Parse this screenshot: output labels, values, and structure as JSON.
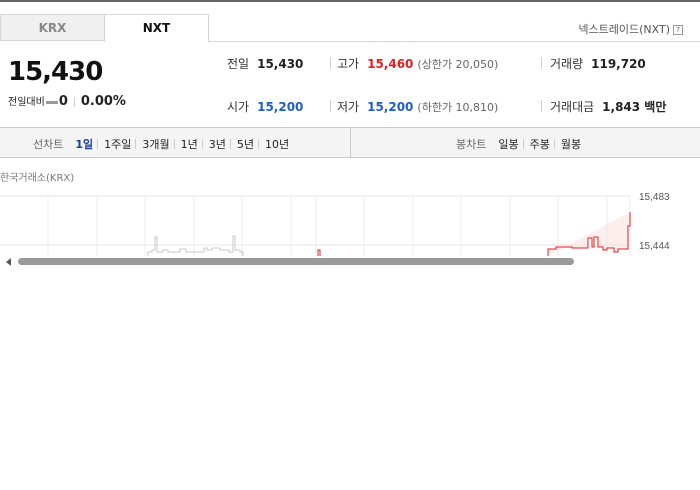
{
  "market_tabs": [
    {
      "label": "KRX",
      "active": false
    },
    {
      "label": "NXT",
      "active": true
    }
  ],
  "nxt_title": "넥스트레이드(NXT)",
  "help_icon": "?",
  "price": "15,430",
  "change": {
    "label": "전일대비",
    "value": "0",
    "percent": "0.00%"
  },
  "quote": {
    "prev_label": "전일",
    "prev": "15,430",
    "high_label": "고가",
    "high": "15,460",
    "upper_limit": "(상한가 20,050)",
    "volume_label": "거래량",
    "volume": "119,720",
    "open_label": "시가",
    "open": "15,200",
    "low_label": "저가",
    "low": "15,200",
    "lower_limit": "(하한가 10,810)",
    "amount_label": "거래대금",
    "amount": "1,843 백만"
  },
  "line_chart_ctrl": {
    "label": "선차트",
    "items": [
      "1일",
      "1주일",
      "3개월",
      "1년",
      "3년",
      "5년",
      "10년"
    ],
    "selected": "1일"
  },
  "candle_chart_ctrl": {
    "label": "봉차트",
    "items": [
      "일봉",
      "주봉",
      "월봉"
    ]
  },
  "exchange_label": "한국거래소(KRX)",
  "chart_axis": {
    "top_label": "15,483",
    "mid_label": "15,444"
  },
  "colors": {
    "up": "#e02020",
    "down": "#1e5ec8",
    "selected": "#1a3fa0"
  }
}
